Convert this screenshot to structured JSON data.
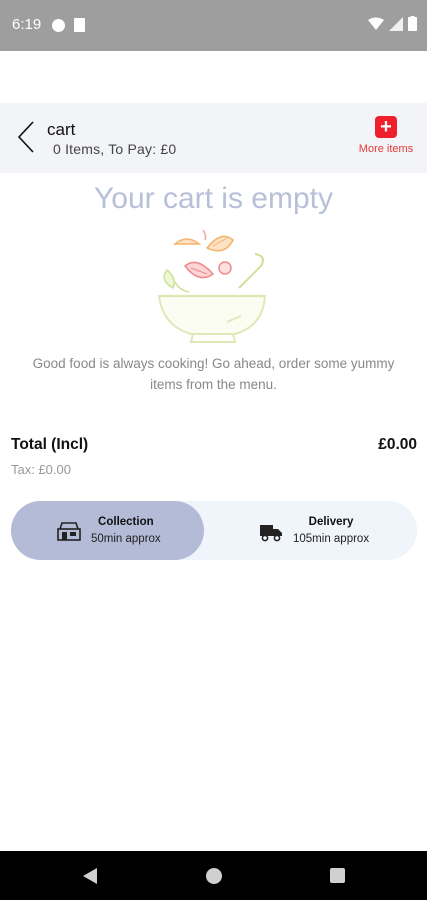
{
  "status_bar": {
    "time": "6:19"
  },
  "header": {
    "title": "cart",
    "subtitle": "0 Items, To Pay: £0",
    "more_items_label": "More items"
  },
  "empty_state": {
    "title": "Your cart is empty",
    "message": "Good food is always cooking! Go ahead, order some yummy items from the menu."
  },
  "totals": {
    "total_label": "Total (Incl)",
    "total_value": "£0.00",
    "tax_line": "Tax: £0.00"
  },
  "fulfillment": {
    "selected": "collection",
    "collection": {
      "name": "Collection",
      "time": "50min approx"
    },
    "delivery": {
      "name": "Delivery",
      "time": "105min approx"
    }
  },
  "colors": {
    "accent_red": "#ef1f2c",
    "selected_pill": "#b3bbd6",
    "toggle_track": "#f0f4fb",
    "empty_title": "#b7bfd9"
  },
  "icons": [
    "back-icon",
    "plus-icon",
    "collection-icon",
    "delivery-icon",
    "salad-bowl-illustration"
  ]
}
